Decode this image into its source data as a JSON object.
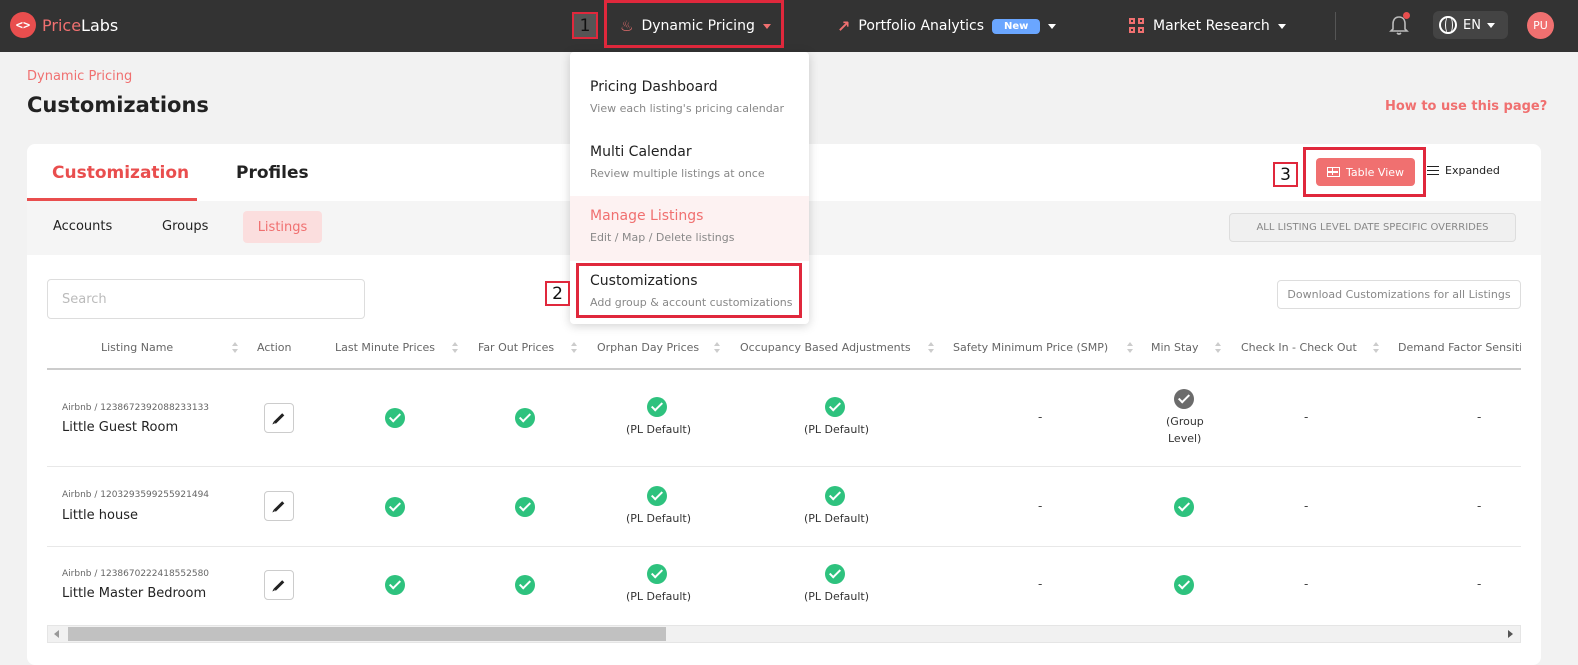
{
  "topbar": {
    "logo_mark": "<>",
    "logo_price": "Price",
    "logo_labs": "Labs",
    "nav": [
      {
        "label": "Dynamic Pricing",
        "icon": "fire-icon"
      },
      {
        "label": "Portfolio Analytics",
        "badge": "New",
        "icon": "trend-icon"
      },
      {
        "label": "Market Research",
        "icon": "grid-icon"
      }
    ],
    "language": "EN",
    "avatar": "PU"
  },
  "annotations": [
    "1",
    "2",
    "3"
  ],
  "dropdown": {
    "items": [
      {
        "title": "Pricing Dashboard",
        "subtitle": "View each listing's pricing calendar"
      },
      {
        "title": "Multi Calendar",
        "subtitle": "Review multiple listings at once"
      },
      {
        "title": "Manage Listings",
        "subtitle": "Edit / Map / Delete listings"
      },
      {
        "title": "Customizations",
        "subtitle": "Add group & account customizations"
      }
    ]
  },
  "header": {
    "breadcrumb": "Dynamic Pricing",
    "title": "Customizations",
    "help_link": "How to use this page?"
  },
  "tabs": {
    "main": [
      "Customization",
      "Profiles"
    ],
    "sub": [
      "Accounts",
      "Groups",
      "Listings"
    ],
    "view_toggle": [
      "Table View",
      "Expanded"
    ],
    "overrides_button": "ALL LISTING LEVEL DATE SPECIFIC OVERRIDES"
  },
  "search": {
    "placeholder": "Search"
  },
  "download_button": "Download Customizations for all Listings",
  "table": {
    "columns": [
      "Listing Name",
      "Action",
      "Last Minute Prices",
      "Far Out Prices",
      "Orphan Day Prices",
      "Occupancy Based Adjustments",
      "Safety Minimum Price (SMP)",
      "Min Stay",
      "Check In - Check Out",
      "Demand Factor Sensiti"
    ],
    "rows": [
      {
        "id": "Airbnb / 1238672392088233133",
        "name": "Little Guest Room",
        "orphan_note": "(PL Default)",
        "occupancy_note": "(PL Default)",
        "smp": "-",
        "min_stay_note_1": "(Group",
        "min_stay_note_2": "Level)",
        "checkin": "-",
        "demand": "-"
      },
      {
        "id": "Airbnb / 1203293599255921494",
        "name": "Little house",
        "orphan_note": "(PL Default)",
        "occupancy_note": "(PL Default)",
        "smp": "-",
        "checkin": "-",
        "demand": "-"
      },
      {
        "id": "Airbnb / 1238670222418552580",
        "name": "Little Master Bedroom",
        "orphan_note": "(PL Default)",
        "occupancy_note": "(PL Default)",
        "smp": "-",
        "checkin": "-",
        "demand": "-"
      }
    ]
  },
  "colors": {
    "brand": "#e94e4e",
    "accent": "#f07070",
    "success": "#2ec27e",
    "topbar": "#333333",
    "highlight": "#e0283c"
  }
}
